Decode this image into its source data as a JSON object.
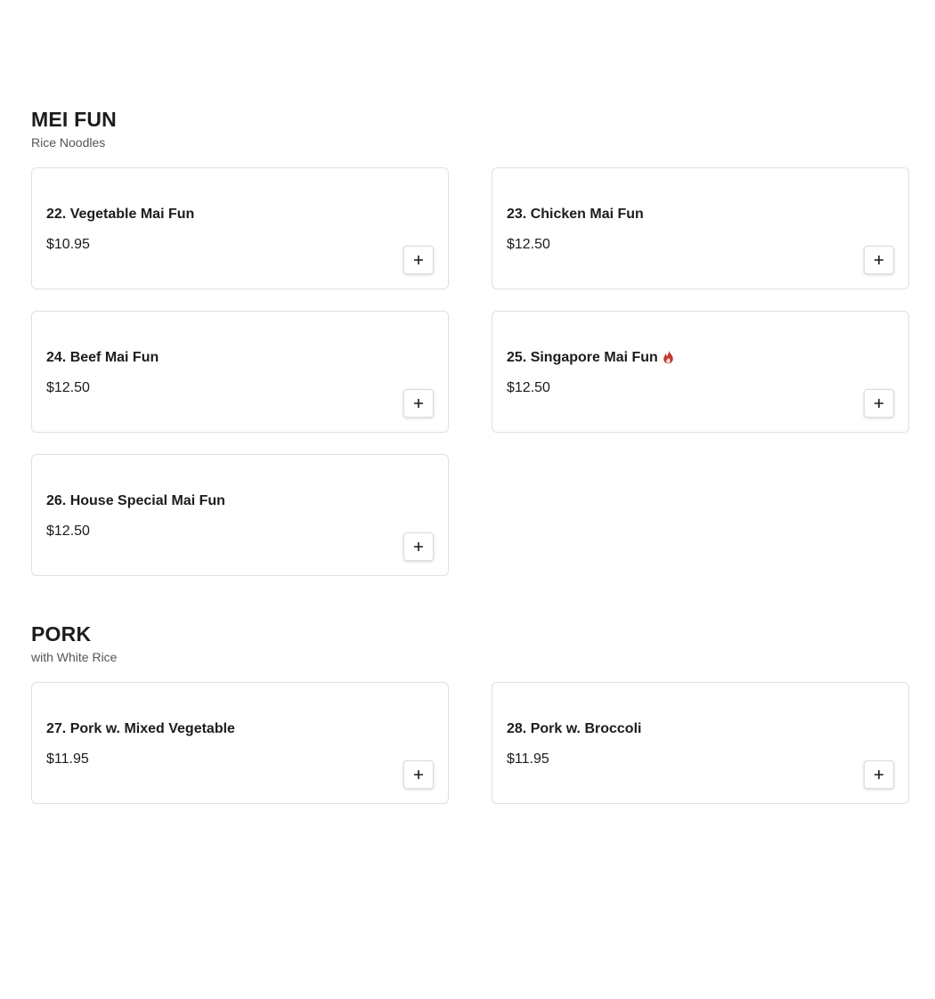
{
  "accent_color": "#c0392b",
  "sections": [
    {
      "title": "MEI FUN",
      "subtitle": "Rice Noodles",
      "items": [
        {
          "name": "22. Vegetable Mai Fun",
          "price": "$10.95"
        },
        {
          "name": "23. Chicken Mai Fun",
          "price": "$12.50"
        },
        {
          "name": "24. Beef Mai Fun",
          "price": "$12.50"
        },
        {
          "name": "25. Singapore Mai Fun",
          "price": "$12.50",
          "icon": "spicy-flame-icon"
        },
        {
          "name": "26. House Special Mai Fun",
          "price": "$12.50"
        }
      ]
    },
    {
      "title": "PORK",
      "subtitle": "with White Rice",
      "items": [
        {
          "name": "27. Pork w. Mixed Vegetable",
          "price": "$11.95"
        },
        {
          "name": "28. Pork w. Broccoli",
          "price": "$11.95"
        }
      ]
    }
  ],
  "add_button_icon": "plus-icon"
}
